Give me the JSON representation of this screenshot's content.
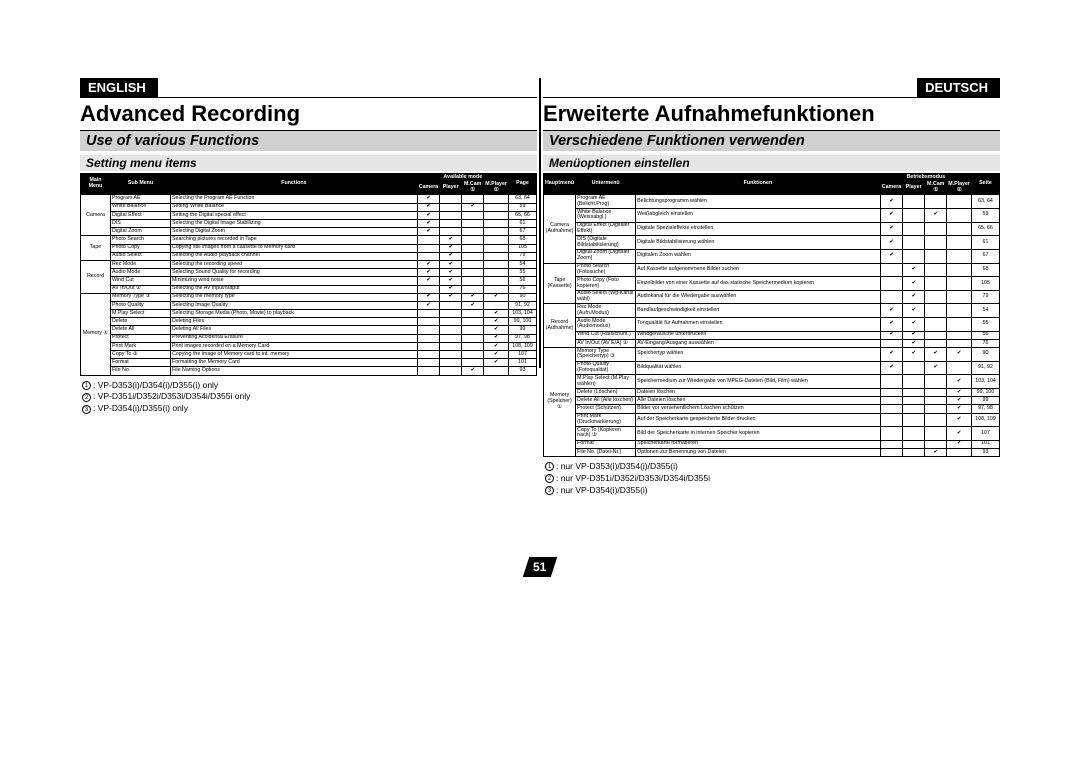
{
  "en": {
    "lang": "ENGLISH",
    "chapter": "Advanced Recording",
    "section": "Use of various Functions",
    "subtitle": "Setting menu items",
    "headers": {
      "main": "Main\nMenu",
      "sub": "Sub Menu",
      "func": "Functions",
      "mode": "Available mode",
      "m1": "Camera",
      "m2": "Player",
      "m3": "M.Cam ①",
      "m4": "M.Player ①",
      "page": "Page"
    },
    "groups": [
      {
        "cat": "Camera",
        "rows": [
          {
            "sub": "Program AE",
            "func": "Selecting the Program AE Function",
            "m": [
              1,
              0,
              0,
              0
            ],
            "pg": "63, 64"
          },
          {
            "sub": "White Balance",
            "func": "Setting White Balance",
            "m": [
              1,
              0,
              1,
              0
            ],
            "pg": "59"
          },
          {
            "sub": "Digital Effect",
            "func": "Setting the Digital special effect",
            "m": [
              1,
              0,
              0,
              0
            ],
            "pg": "65, 66"
          },
          {
            "sub": "DIS",
            "func": "Selecting the Digital Image Stabilizing",
            "m": [
              1,
              0,
              0,
              0
            ],
            "pg": "61"
          },
          {
            "sub": "Digital Zoom",
            "func": "Selecting Digital Zoom",
            "m": [
              1,
              0,
              0,
              0
            ],
            "pg": "67"
          }
        ]
      },
      {
        "cat": "Tape",
        "rows": [
          {
            "sub": "Photo Search",
            "func": "Searching pictures recorded in Tape",
            "m": [
              0,
              1,
              0,
              0
            ],
            "pg": "68"
          },
          {
            "sub": "Photo Copy",
            "func": "Copying still images from a cassette to Memory card",
            "m": [
              0,
              1,
              0,
              0
            ],
            "pg": "105"
          },
          {
            "sub": "Audio Select",
            "func": "Selecting the Audio playback channel",
            "m": [
              0,
              1,
              0,
              0
            ],
            "pg": "79"
          }
        ]
      },
      {
        "cat": "Record",
        "rows": [
          {
            "sub": "Rec Mode",
            "func": "Selecting the recording speed",
            "m": [
              1,
              1,
              0,
              0
            ],
            "pg": "54"
          },
          {
            "sub": "Audio Mode",
            "func": "Selecting Sound Quality for recording",
            "m": [
              1,
              1,
              0,
              0
            ],
            "pg": "55"
          },
          {
            "sub": "Wind Cut",
            "func": "Minimizing wind noise",
            "m": [
              1,
              1,
              0,
              0
            ],
            "pg": "56"
          },
          {
            "sub": "AV In/Out ②",
            "func": "Selecting the AV input/output",
            "m": [
              0,
              1,
              0,
              0
            ],
            "pg": "76"
          }
        ]
      },
      {
        "cat": "Memory ①",
        "rows": [
          {
            "sub": "Memory Type ③",
            "func": "Selecting the memory type",
            "m": [
              1,
              1,
              1,
              1
            ],
            "pg": "90"
          },
          {
            "sub": "Photo Quality",
            "func": "Selecting Image Quality",
            "m": [
              1,
              0,
              1,
              0
            ],
            "pg": "91, 92"
          },
          {
            "sub": "M.Play Select",
            "func": "Selecting Storage Media (Photo, Movie) to playback",
            "m": [
              0,
              0,
              0,
              1
            ],
            "pg": "103, 104"
          },
          {
            "sub": "Delete",
            "func": "Deleting Files",
            "m": [
              0,
              0,
              0,
              1
            ],
            "pg": "99, 100"
          },
          {
            "sub": "Delete All",
            "func": "Deleting All Files",
            "m": [
              0,
              0,
              0,
              1
            ],
            "pg": "99"
          },
          {
            "sub": "Protect",
            "func": "Preventing Accidental Erasure",
            "m": [
              0,
              0,
              0,
              1
            ],
            "pg": "97, 98"
          },
          {
            "sub": "Print Mark",
            "func": "Print images recorded on a Memory Card",
            "m": [
              0,
              0,
              0,
              1
            ],
            "pg": "108, 109"
          },
          {
            "sub": "Copy To ③",
            "func": "Copying the image of Memory card to int. memory",
            "m": [
              0,
              0,
              0,
              1
            ],
            "pg": "107"
          },
          {
            "sub": "Format",
            "func": "Formatting the Memory Card",
            "m": [
              0,
              0,
              0,
              1
            ],
            "pg": "101"
          },
          {
            "sub": "File No.",
            "func": "File Naming Options",
            "m": [
              0,
              0,
              1,
              0
            ],
            "pg": "93"
          }
        ]
      }
    ],
    "notes": [
      "①: VP-D353(i)/D354(i)/D355(i) only",
      "②: VP-D351i/D352i/D353i/D354i/D355i only",
      "③: VP-D354(i)/D355(i) only"
    ]
  },
  "de": {
    "lang": "DEUTSCH",
    "chapter": "Erweiterte Aufnahmefunktionen",
    "section": "Verschiedene Funktionen verwenden",
    "subtitle": "Menüoptionen einstellen",
    "headers": {
      "main": "Hauptmenü",
      "sub": "Untermenü",
      "func": "Funktionen",
      "mode": "Betriebsmodus",
      "m1": "Camera",
      "m2": "Player",
      "m3": "M.Cam ①",
      "m4": "M.Player ①",
      "page": "Seite"
    },
    "groups": [
      {
        "cat": "Camera (Aufnahme)",
        "rows": [
          {
            "sub": "Program AE (Belicht.Prog)",
            "func": "Belichtungsprogramm wählen",
            "m": [
              1,
              0,
              0,
              0
            ],
            "pg": "63, 64"
          },
          {
            "sub": "White Balance (Weissabgl.)",
            "func": "Weißabgleich einstellen",
            "m": [
              1,
              0,
              1,
              0
            ],
            "pg": "59"
          },
          {
            "sub": "Digital Effect (Digitaler Effekt)",
            "func": "Digitale Spezialeffekte einstellen",
            "m": [
              1,
              0,
              0,
              0
            ],
            "pg": "65, 66"
          },
          {
            "sub": "DIS (Digitale Bildstabilisierung)",
            "func": "Digitale Bildstabilisierung wählen",
            "m": [
              1,
              0,
              0,
              0
            ],
            "pg": "61"
          },
          {
            "sub": "Digital Zoom (Digitaler Zoom)",
            "func": "Digitalen Zoom wählen",
            "m": [
              1,
              0,
              0,
              0
            ],
            "pg": "67"
          }
        ]
      },
      {
        "cat": "Tape (Kassette)",
        "rows": [
          {
            "sub": "Photo Search (Fotosuche)",
            "func": "Auf Kassette aufgenommene Bilder suchen",
            "m": [
              0,
              1,
              0,
              0
            ],
            "pg": "68"
          },
          {
            "sub": "Photo Copy (Foto kopieren)",
            "func": "Einzelbilder von einer Kassette auf das statische Speichermedium kopieren",
            "m": [
              0,
              1,
              0,
              0
            ],
            "pg": "105"
          },
          {
            "sub": "Audio Select (Wg-Kanal wähl)",
            "func": "Audiokanal für die Wiedergabe auswählen",
            "m": [
              0,
              1,
              0,
              0
            ],
            "pg": "79"
          }
        ]
      },
      {
        "cat": "Record (Aufnahme)",
        "rows": [
          {
            "sub": "Rec Mode (Aufn.Modus)",
            "func": "Bandlaufgeschwindigkeit einstellen",
            "m": [
              1,
              1,
              0,
              0
            ],
            "pg": "54"
          },
          {
            "sub": "Audio Mode (Audiomodus)",
            "func": "Tonqualität für Aufnahmen einstellen",
            "m": [
              1,
              1,
              0,
              0
            ],
            "pg": "55"
          },
          {
            "sub": "Wind Cut (Rauschunt.)",
            "func": "Windgeräusche unterdrücken",
            "m": [
              1,
              1,
              0,
              0
            ],
            "pg": "56"
          },
          {
            "sub": "AV In/Out (AV E/A) ②",
            "func": "AV-Eingang/Ausgang auswählen",
            "m": [
              0,
              1,
              0,
              0
            ],
            "pg": "76"
          }
        ]
      },
      {
        "cat": "Memory (Speicher) ①",
        "rows": [
          {
            "sub": "Memory Type (Speichertyp) ③",
            "func": "Speichertyp wählen",
            "m": [
              1,
              1,
              1,
              1
            ],
            "pg": "90"
          },
          {
            "sub": "Photo Quality (Fotoqualität)",
            "func": "Bildqualität wählen",
            "m": [
              1,
              0,
              1,
              0
            ],
            "pg": "91, 92"
          },
          {
            "sub": "M.Play Select (M.Play wählen)",
            "func": "Speichermedium zur Wiedergabe von MPEG-Dateien (Bild, Film) wählen",
            "m": [
              0,
              0,
              0,
              1
            ],
            "pg": "103, 104"
          },
          {
            "sub": "Delete (Löschen)",
            "func": "Dateien löschen",
            "m": [
              0,
              0,
              0,
              1
            ],
            "pg": "99, 100"
          },
          {
            "sub": "Delete All (Alle löschen)",
            "func": "Alle Dateien löschen",
            "m": [
              0,
              0,
              0,
              1
            ],
            "pg": "99"
          },
          {
            "sub": "Protect (Schützen)",
            "func": "Bilder vor versehentlichem Löschen schützen",
            "m": [
              0,
              0,
              0,
              1
            ],
            "pg": "97, 98"
          },
          {
            "sub": "Print Mark (Druckmarkierung)",
            "func": "Auf der Speicherkarte gespeicherte Bilder drucken",
            "m": [
              0,
              0,
              0,
              1
            ],
            "pg": "108, 109"
          },
          {
            "sub": "Copy To (Kopieren nach) ③",
            "func": "Bild der Speicherkarte in internen Speicher kopieren",
            "m": [
              0,
              0,
              0,
              1
            ],
            "pg": "107"
          },
          {
            "sub": "Format",
            "func": "Speicherkarte formatieren",
            "m": [
              0,
              0,
              0,
              1
            ],
            "pg": "101"
          },
          {
            "sub": "File No. (Datei-Nr.)",
            "func": "Optionen zur Benennung von Dateien",
            "m": [
              0,
              0,
              1,
              0
            ],
            "pg": "93"
          }
        ]
      }
    ],
    "notes": [
      "①: nur VP-D353(i)/D354(i)/D355(i)",
      "②: nur VP-D351i/D352i/D353i/D354i/D355i",
      "③: nur VP-D354(i)/D355(i)"
    ]
  },
  "pagenum": "51"
}
